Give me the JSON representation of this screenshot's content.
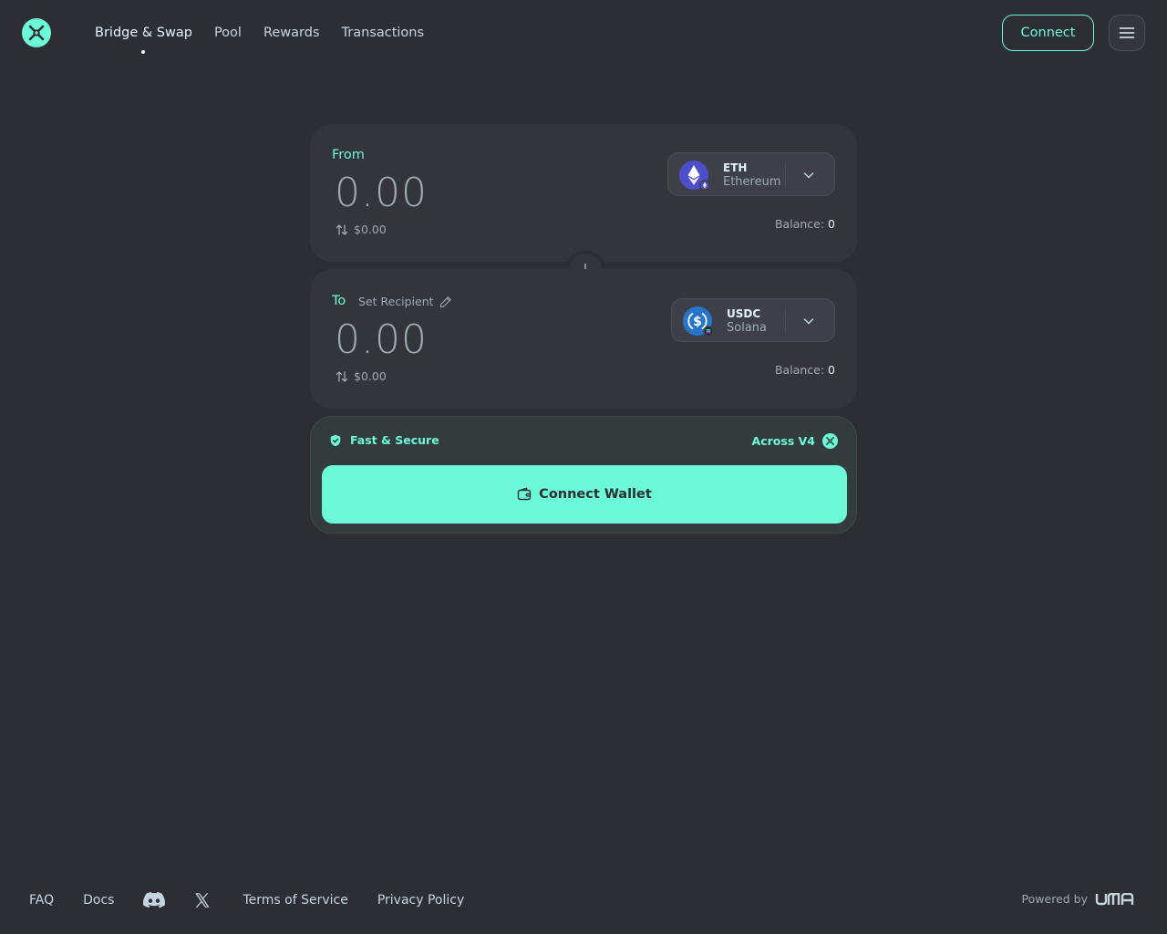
{
  "header": {
    "nav": [
      {
        "label": "Bridge & Swap",
        "active": true
      },
      {
        "label": "Pool",
        "active": false
      },
      {
        "label": "Rewards",
        "active": false
      },
      {
        "label": "Transactions",
        "active": false
      }
    ],
    "connect_label": "Connect"
  },
  "from": {
    "label": "From",
    "amount": "0.00",
    "usd_value": "$0.00",
    "token": {
      "symbol": "ETH",
      "chain": "Ethereum",
      "icon": "eth-icon"
    },
    "balance_label": "Balance:",
    "balance_value": "0"
  },
  "to": {
    "label": "To",
    "set_recipient": "Set Recipient",
    "amount": "0.00",
    "usd_value": "$0.00",
    "token": {
      "symbol": "USDC",
      "chain": "Solana",
      "icon": "usdc-icon"
    },
    "balance_label": "Balance:",
    "balance_value": "0"
  },
  "action": {
    "fast_secure": "Fast & Secure",
    "protocol": "Across V4",
    "button_label": "Connect Wallet"
  },
  "footer": {
    "links": [
      "FAQ",
      "Docs",
      "Terms of Service",
      "Privacy Policy"
    ],
    "powered_by": "Powered by",
    "brand": "UMA"
  },
  "colors": {
    "background": "#2d2e33",
    "card": "#34353b",
    "accent": "#6cf9d8",
    "text_muted": "#9daab2"
  }
}
